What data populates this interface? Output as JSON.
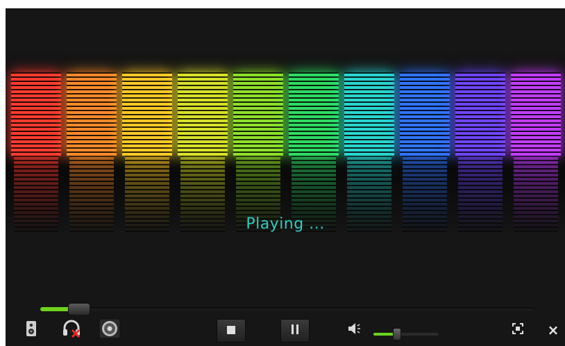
{
  "status": {
    "text": "Playing ..."
  },
  "playback": {
    "progress": 0.07
  },
  "volume": {
    "level": 0.35
  },
  "controls": {
    "speaker": {
      "icon": "speaker-icon"
    },
    "headphones": {
      "icon": "headphones-muted-icon"
    },
    "effects": {
      "icon": "disc-icon"
    },
    "stop": {
      "icon": "stop-icon"
    },
    "pause": {
      "icon": "pause-icon"
    },
    "volume": {
      "icon": "volume-icon"
    },
    "fullscreen": {
      "icon": "fullscreen-icon"
    },
    "close": {
      "label": "×",
      "icon": "close-icon"
    }
  },
  "colors": {
    "accent": "#6fd21f",
    "status_text": "#36c8c2",
    "mute_x": "#e0302a",
    "bands": [
      "#ff3b2f",
      "#ff8a2a",
      "#ffc928",
      "#d9e12a",
      "#8fe02b",
      "#2fdc63",
      "#2ad6d0",
      "#2f74ff",
      "#6f46ff",
      "#c33cff"
    ]
  }
}
